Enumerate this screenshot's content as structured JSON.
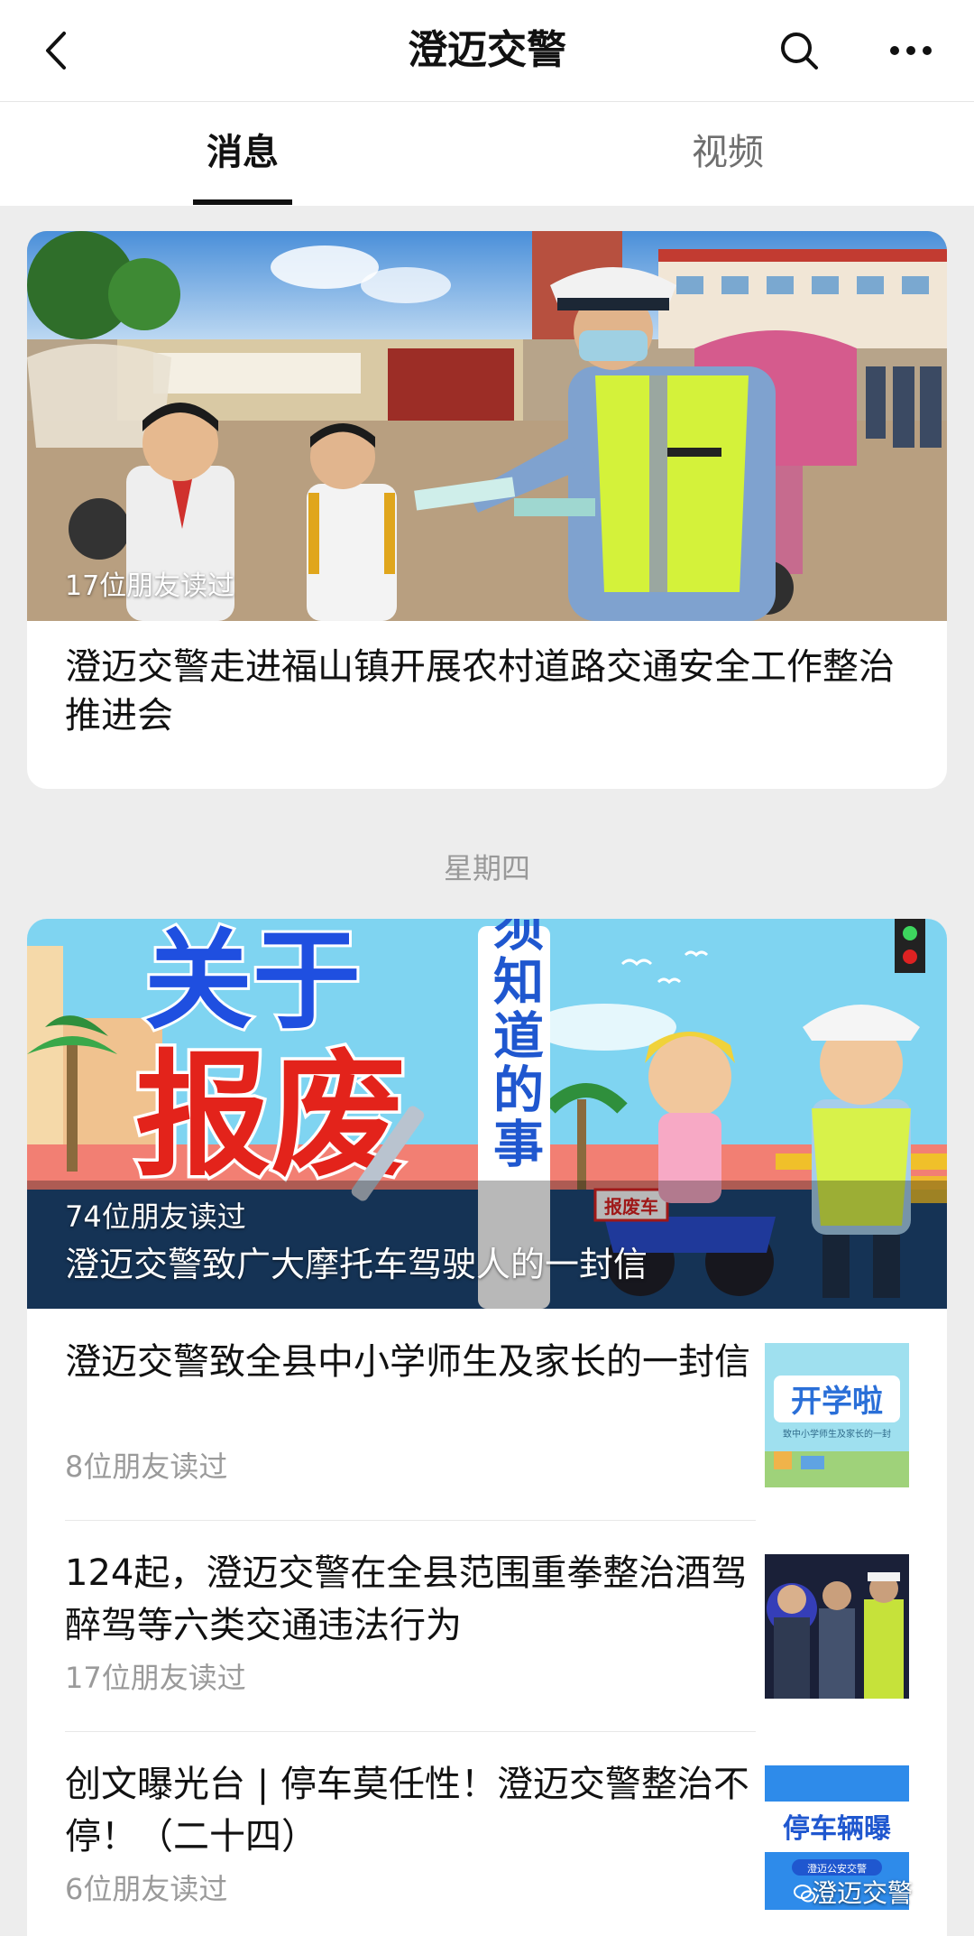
{
  "header": {
    "title": "澄迈交警",
    "back_icon": "chevron-left-icon",
    "search_icon": "search-icon",
    "more_icon": "more-dots-icon"
  },
  "tabs": [
    {
      "label": "消息",
      "active": true
    },
    {
      "label": "视频",
      "active": false
    }
  ],
  "feed": {
    "top_article": {
      "read_count": "17位朋友读过",
      "title": "澄迈交警走进福山镇开展农村道路交通安全工作整治推进会"
    },
    "day_label": "星期四",
    "featured_article": {
      "read_count": "74位朋友读过",
      "title": "澄迈交警致广大摩托车驾驶人的一封信",
      "image_text": {
        "line1": "关于",
        "line2": "报废",
        "vertical": "你必须知道的事",
        "sign": "报废车"
      }
    },
    "list": [
      {
        "title": "澄迈交警致全县中小学师生及家长的一封信",
        "read_count": "8位朋友读过",
        "thumb_text": "开学啦",
        "thumb_subtext": "致中小学师生及家长的一封"
      },
      {
        "title": "124起，澄迈交警在全县范围重拳整治酒驾醉驾等六类交通违法行为",
        "read_count": "17位朋友读过"
      },
      {
        "title": "创文曝光台 | 停车莫任性！澄迈交警整治不停！（二十四）",
        "read_count": "6位朋友读过",
        "thumb_text": "停车辆曝",
        "thumb_subtext": "澄迈公安交警"
      }
    ]
  },
  "watermark": "澄迈交警",
  "colors": {
    "background": "#ededed",
    "card": "#ffffff",
    "text_primary": "#111111",
    "text_secondary": "#9a9a9a"
  }
}
